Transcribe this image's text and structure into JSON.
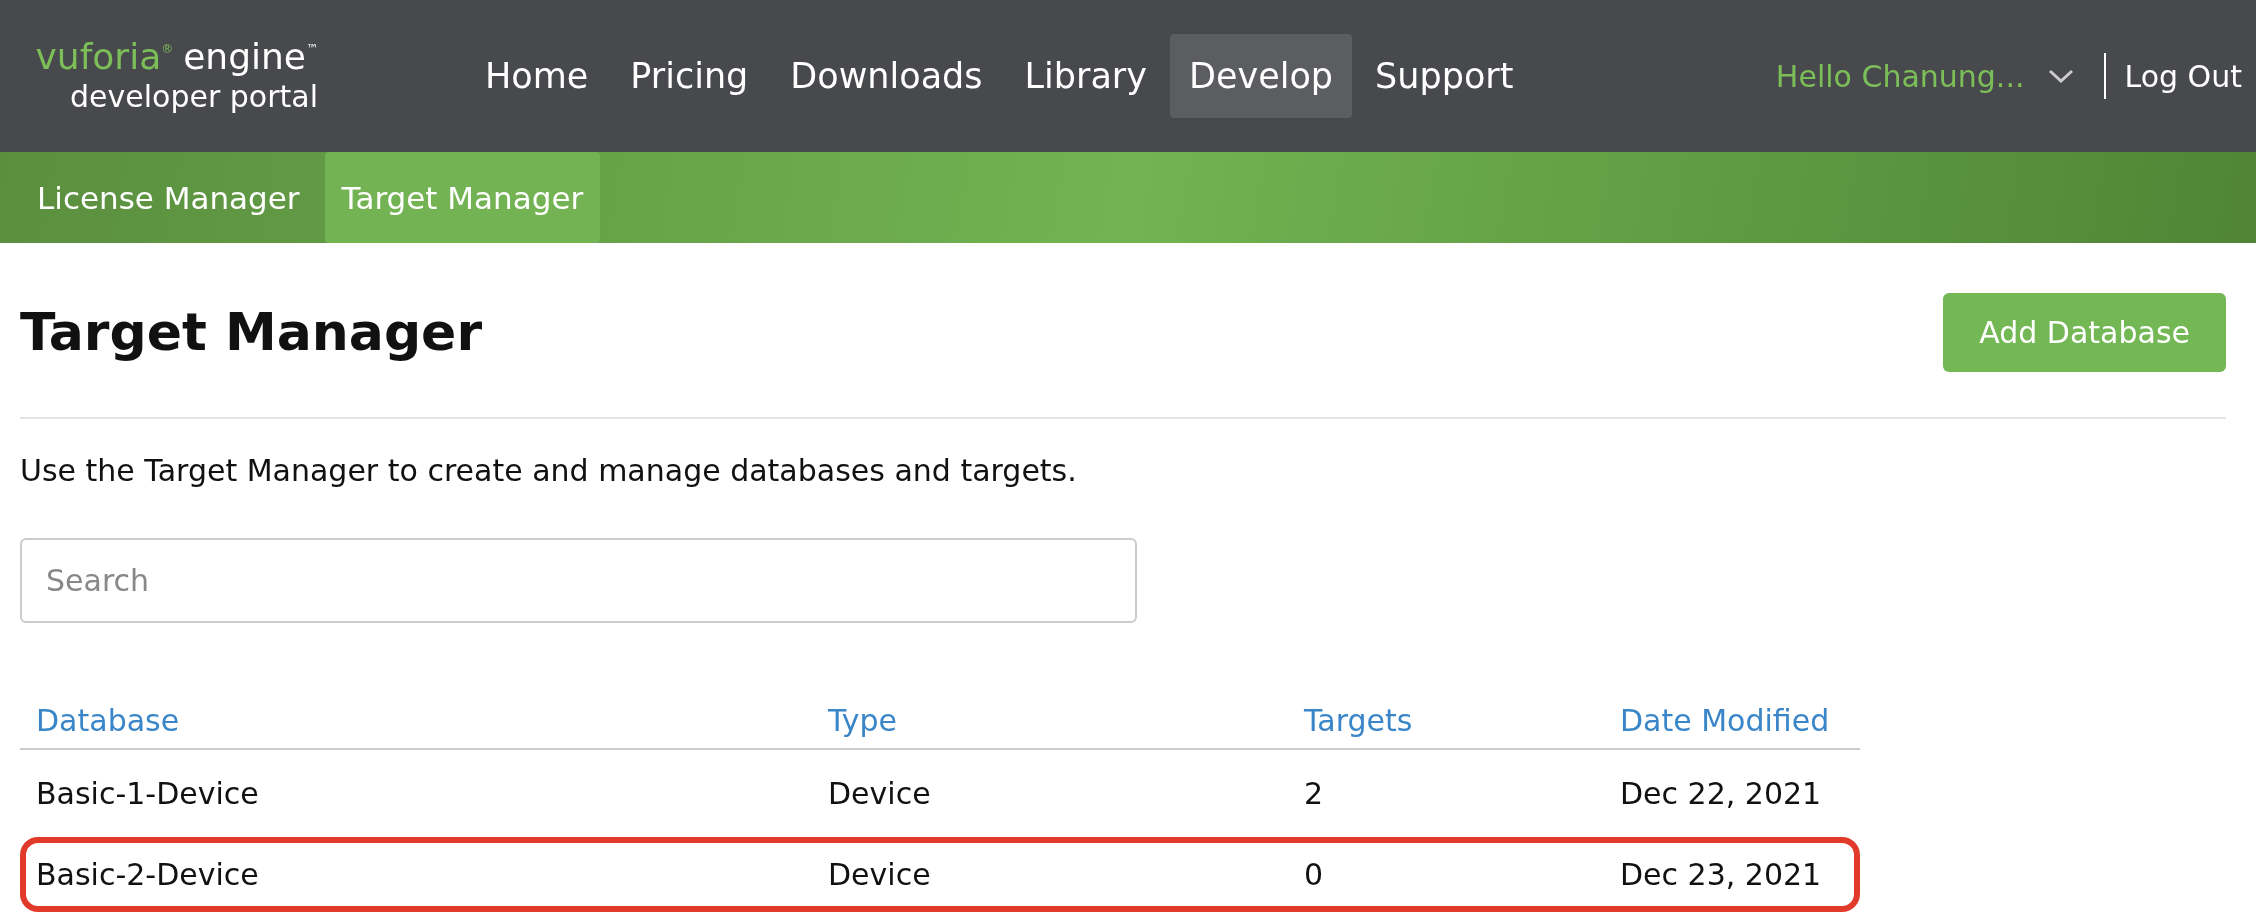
{
  "logo": {
    "brand": "vuforia",
    "brand_mark": "®",
    "product": "engine",
    "product_mark": "™",
    "subtitle": "developer portal"
  },
  "nav": [
    {
      "label": "Home",
      "selected": false
    },
    {
      "label": "Pricing",
      "selected": false
    },
    {
      "label": "Downloads",
      "selected": false
    },
    {
      "label": "Library",
      "selected": false
    },
    {
      "label": "Develop",
      "selected": true
    },
    {
      "label": "Support",
      "selected": false
    }
  ],
  "user": {
    "greeting": "Hello Chanung...",
    "logout": "Log Out"
  },
  "subnav": [
    {
      "label": "License Manager",
      "selected": false
    },
    {
      "label": "Target Manager",
      "selected": true
    }
  ],
  "page": {
    "title": "Target Manager",
    "add_button": "Add Database",
    "description": "Use the Target Manager to create and manage databases and targets.",
    "search": {
      "placeholder": "Search"
    }
  },
  "table": {
    "columns": [
      "Database",
      "Type",
      "Targets",
      "Date Modified"
    ],
    "rows": [
      {
        "cells": [
          "Basic-1-Device",
          "Device",
          "2",
          "Dec 22, 2021"
        ],
        "highlighted": false
      },
      {
        "cells": [
          "Basic-2-Device",
          "Device",
          "0",
          "Dec 23, 2021"
        ],
        "highlighted": true
      }
    ]
  }
}
